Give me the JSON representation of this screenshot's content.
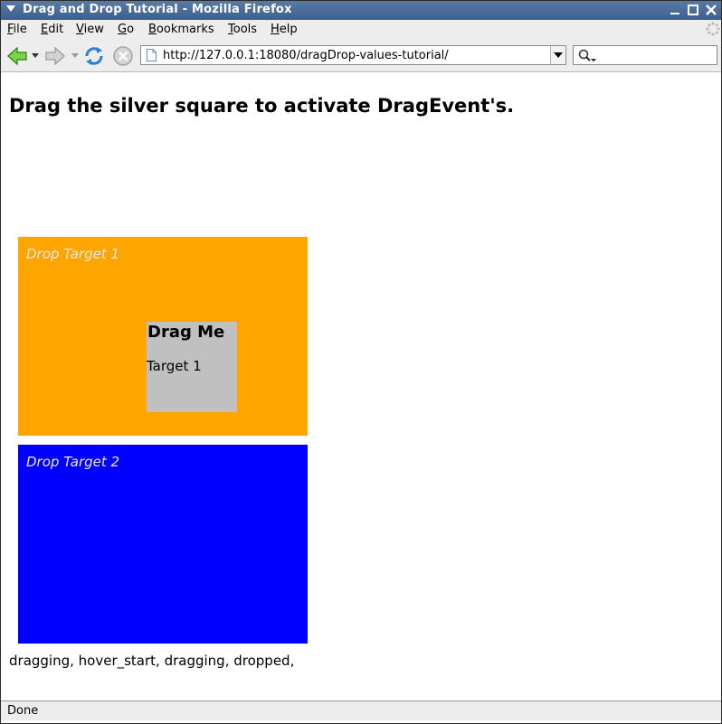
{
  "window": {
    "title": "Drag and Drop Tutorial - Mozilla Firefox"
  },
  "menu": {
    "items": [
      {
        "label": "File"
      },
      {
        "label": "Edit"
      },
      {
        "label": "View"
      },
      {
        "label": "Go"
      },
      {
        "label": "Bookmarks"
      },
      {
        "label": "Tools"
      },
      {
        "label": "Help"
      }
    ]
  },
  "toolbar": {
    "url": "http://127.0.0.1:18080/dragDrop-values-tutorial/",
    "search_value": ""
  },
  "page": {
    "heading": "Drag the silver square to activate DragEvent's.",
    "drop_target_1": "Drop Target 1",
    "drop_target_2": "Drop Target 2",
    "drag_box_title": "Drag Me",
    "drag_box_status": "Target 1",
    "event_log": "dragging, hover_start, dragging, dropped,"
  },
  "status": {
    "text": "Done"
  },
  "colors": {
    "drop_target_1": "#ffa500",
    "drop_target_2": "#0000ff",
    "drag_box": "#c0c0c0"
  }
}
